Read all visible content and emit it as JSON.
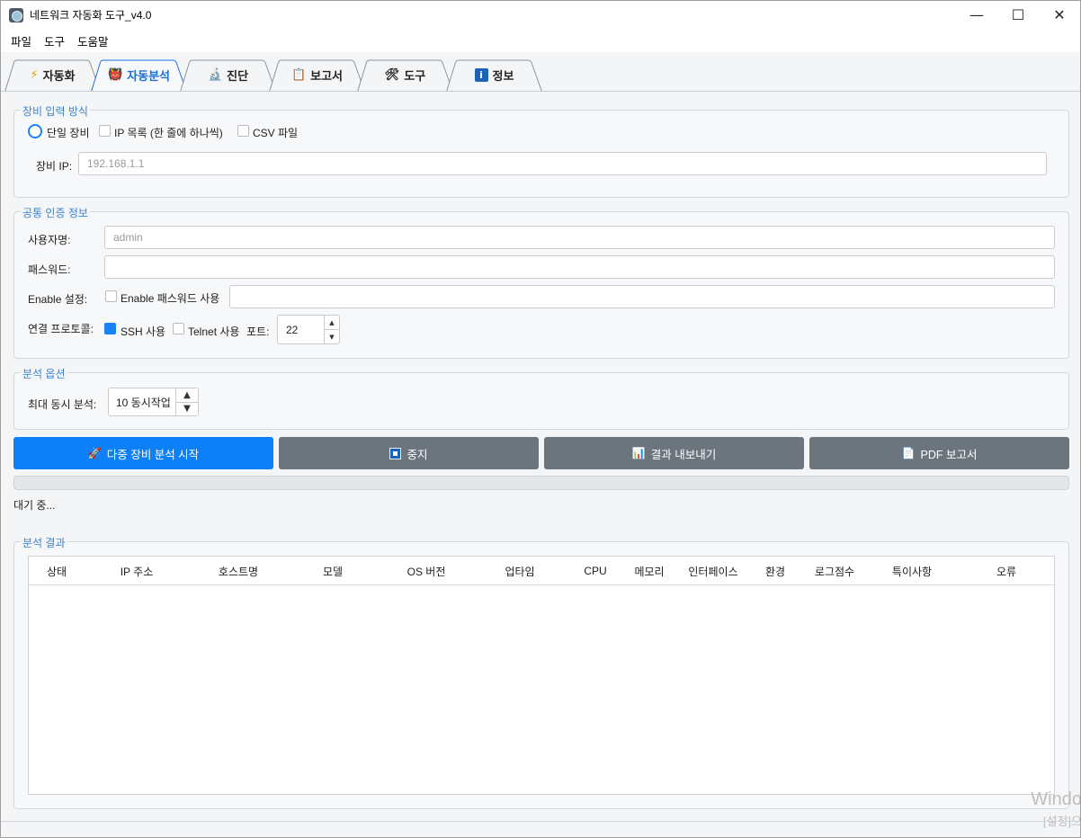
{
  "window": {
    "title": "네트워크 자동화 도구_v4.0",
    "controls": {
      "minimize": "—",
      "maximize": "☐",
      "close": "✕"
    }
  },
  "menu": [
    "파일",
    "도구",
    "도움말"
  ],
  "tabs": [
    {
      "label": "자동화",
      "icon": "⚡",
      "icon_name": "lightning-icon",
      "active": false
    },
    {
      "label": "자동분석",
      "icon": "👹",
      "icon_name": "mask-icon",
      "active": true
    },
    {
      "label": "진단",
      "icon": "🔬",
      "icon_name": "microscope-icon",
      "active": false
    },
    {
      "label": "보고서",
      "icon": "📋",
      "icon_name": "clipboard-icon",
      "active": false
    },
    {
      "label": "도구",
      "icon": "🛠",
      "icon_name": "tools-icon",
      "active": false
    },
    {
      "label": "정보",
      "icon": "i",
      "icon_name": "info-icon",
      "active": false
    }
  ],
  "device_input": {
    "title": "장비 입력 방식",
    "mode_single": "단일 장비",
    "mode_list": "IP 목록 (한 줄에 하나씩)",
    "mode_csv": "CSV 파일",
    "selected_mode": "단일 장비",
    "ip_label": "장비 IP:",
    "ip_placeholder": "192.168.1.1"
  },
  "auth": {
    "title": "공통 인증 정보",
    "username_label": "사용자명:",
    "username_placeholder": "admin",
    "password_label": "패스워드:",
    "password_value": "",
    "enable_label": "Enable 설정:",
    "enable_check_label": "Enable 패스워드 사용",
    "enable_checked": false,
    "enable_value": "",
    "protocol_label": "연결 프로토콜:",
    "ssh_label": "SSH 사용",
    "ssh_checked": true,
    "telnet_label": "Telnet 사용",
    "telnet_checked": false,
    "port_label": "포트:",
    "port_value": "22"
  },
  "options": {
    "title": "분석 옵션",
    "concurrency_label": "최대 동시 분석:",
    "concurrency_value": "10 동시작업"
  },
  "actions": {
    "start": {
      "label": "다중 장비 분석 시작",
      "icon": "🚀",
      "icon_name": "rocket-icon"
    },
    "stop": {
      "label": "중지",
      "icon_name": "stop-icon"
    },
    "export": {
      "label": "결과 내보내기",
      "icon": "📊",
      "icon_name": "bar-chart-icon"
    },
    "pdf": {
      "label": "PDF 보고서",
      "icon": "📄",
      "icon_name": "document-icon"
    }
  },
  "progress": {
    "value": 0
  },
  "status_text": "대기 중...",
  "results": {
    "title": "분석 결과",
    "columns": [
      "상태",
      "IP 주소",
      "호스트명",
      "모델",
      "OS 버전",
      "업타임",
      "CPU",
      "메모리",
      "인터페이스",
      "환경",
      "로그점수",
      "특이사항",
      "오류"
    ],
    "rows": []
  },
  "watermark": {
    "line1": "Windo",
    "line2": "[설정]으"
  },
  "colors": {
    "accent": "#0d7ff7",
    "secondary_button": "#6c757d",
    "group_title": "#3a84d6"
  }
}
